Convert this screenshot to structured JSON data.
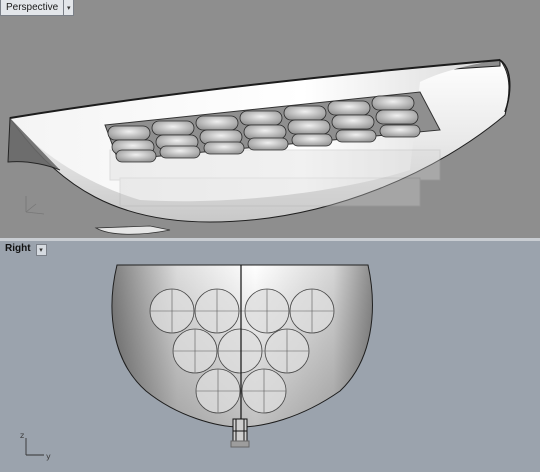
{
  "viewports": {
    "perspective": {
      "label": "Perspective"
    },
    "right": {
      "label": "Right"
    }
  },
  "axes": {
    "z": "z",
    "y": "y"
  }
}
